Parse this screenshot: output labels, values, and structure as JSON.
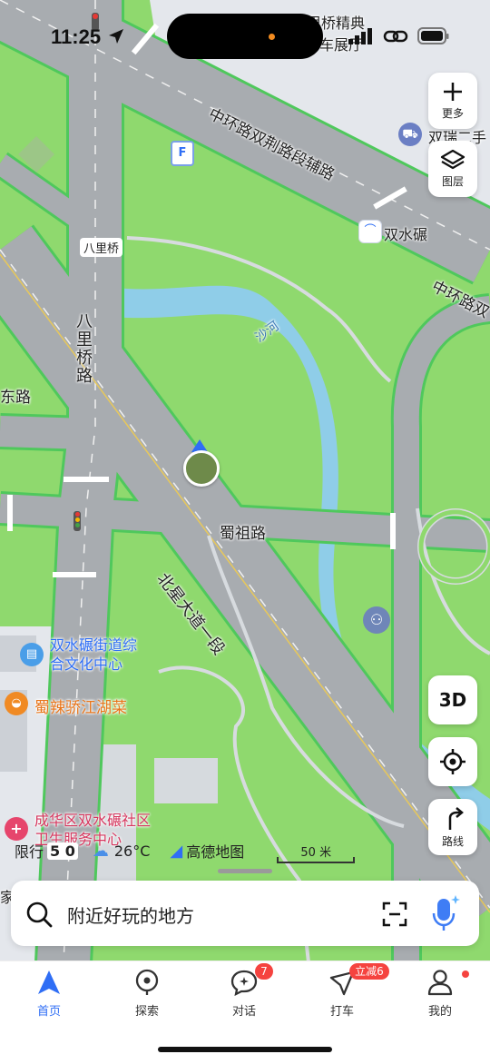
{
  "status_bar": {
    "time": "11:25"
  },
  "map": {
    "labels": {
      "top_poi_line1": "里桥精典",
      "top_poi_line2": "车展厅",
      "ring_aux_road": "中环路双荆路段辅路",
      "shuangrui_poi": "双瑞二手",
      "shuangshuinian_poi": "双水碾",
      "ring_road_east": "中环路双",
      "bali_bridge_small": "八里桥",
      "bali_bridge_road": "八里桥路",
      "shahe": "沙河",
      "east_road_fragment": "东路",
      "shuzu_road": "蜀祖路",
      "beixing_avenue": "北星大道一段",
      "culture_center": "双水碾街道综合文化中心",
      "restaurant": "蜀辣骄江湖菜",
      "health_center": "成华区双水碾社区卫生服务中心",
      "left_edge_fragment": "家",
      "parking_letter": "F"
    },
    "controls": {
      "more_label": "更多",
      "layers_label": "图层",
      "view_3d_label": "3D",
      "route_label": "路线"
    },
    "info": {
      "restriction_label": "限行",
      "restriction_digits": "5 0",
      "weather": "26°C",
      "brand": "高德地图",
      "scale": "50 米"
    }
  },
  "search": {
    "placeholder": "附近好玩的地方"
  },
  "tabs": [
    {
      "label": "首页",
      "active": true
    },
    {
      "label": "探索"
    },
    {
      "label": "对话",
      "badge": "7"
    },
    {
      "label": "打车",
      "badge": "立减6"
    },
    {
      "label": "我的",
      "dot": true
    }
  ],
  "colors": {
    "park_green": "#8fd96e",
    "road_gray": "#a8acb0",
    "road_edge": "#4fc85c",
    "river": "#8fcde8",
    "accent_blue": "#2f6ef5",
    "badge_red": "#f5433f"
  }
}
